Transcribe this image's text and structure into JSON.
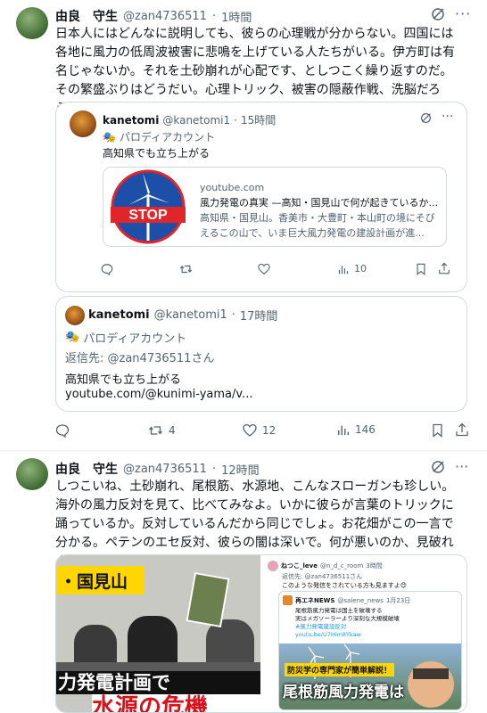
{
  "tweet1": {
    "author_name": "由良　守生",
    "handle": "@zan4736511",
    "time": "1時間",
    "text": "日本人にはどんなに説明しても、彼らの心理戦が分からない。四国には各地に風力の低周波被害に悲鳴を上げている人たちがいる。伊方町は有名じゃないか。それを土砂崩れが心配です、としつこく繰り返すのだ。その繁盛ぶりはどうだい。心理トリック、被害の隠蔽作戦、洗脳だろう。",
    "quote": {
      "author_name": "kanetomi",
      "handle": "@kanetomi1",
      "time": "15時間",
      "parody_label": "パロディアカウント",
      "text": "高知県でも立ち上がる",
      "link_card": {
        "domain": "youtube.com",
        "title": "風力発電の真実 —高知・国見山で何が起きているか...",
        "description": "高知県・国見山。香美市・大豊町・本山町の境にそびえるこの山で、いま巨大風力発電の建設計画が進...",
        "thumb_text": "STOP"
      },
      "actions": {
        "views": "10"
      }
    },
    "reply": {
      "author_name": "kanetomi",
      "handle": "@kanetomi1",
      "time": "17時間",
      "parody_label": "パロディアカウント",
      "reply_to": "返信先: @zan4736511さん",
      "text": "高知県でも立ち上がる",
      "link": "youtube.com/@kunimi-yama/v..."
    },
    "actions": {
      "retweets": "4",
      "likes": "12",
      "views": "146"
    }
  },
  "tweet2": {
    "author_name": "由良　守生",
    "handle": "@zan4736511",
    "time": "12時間",
    "text": "しつこいね、土砂崩れ、尾根筋、水源地、こんなスローガンも珍しい。海外の風力反対を見て、比べてみなよ。いかに彼らが言葉のトリックに踊っているか。反対しているんだから同じでしょ。お花畑がこの一言で分かる。ペテンのエセ反対、彼らの闇は深いで。何が悪いのか、見破れよ",
    "media_left": {
      "banner_top": "・国見山",
      "banner_mid": "力発電計画で",
      "banner_bottom": "水源の危機"
    },
    "media_right": {
      "user": "ねつこ_leve",
      "handle": "@n_d_c_room",
      "time": "3時間",
      "reply_to": "返信先: @zan4736511さん",
      "text": "このような発信をされている方も見ますよ😊",
      "inner_user": "再エネNEWS",
      "inner_handle": "@saiene_news",
      "inner_time": "1月23日",
      "inner_lines": [
        "尾根筋風力発電は国土を破壊する",
        "実はメガソーラーより深刻な大規模破壊",
        "#風力発電建設反対",
        "youtu.be/U7Him8Ykaw"
      ],
      "banner_small": "防災学の専門家が簡単解説！",
      "banner_big": "尾根筋風力発電は"
    }
  },
  "colors": {
    "stop_blue": "#1d4fa8",
    "stop_red": "#e0252b",
    "banner_red": "#d8111b",
    "banner_yellow": "#ffd600"
  }
}
